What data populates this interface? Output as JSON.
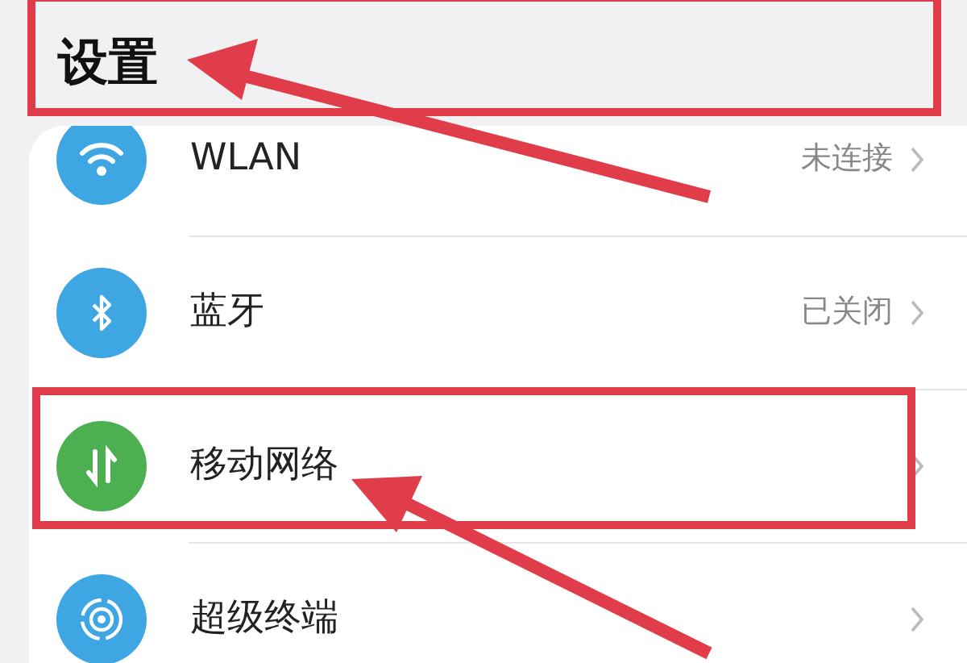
{
  "header": {
    "title": "设置",
    "annotated": true
  },
  "items": [
    {
      "label": "WLAN",
      "value": "未连接",
      "color": "#3fa6e4",
      "annotated": false
    },
    {
      "label": "蓝牙",
      "value": "已关闭",
      "color": "#3fa6e4",
      "annotated": false
    },
    {
      "label": "移动网络",
      "color": "#4caf50",
      "annotated": true
    },
    {
      "label": "超级终端",
      "color": "#3fa6e4",
      "annotated": false
    }
  ]
}
